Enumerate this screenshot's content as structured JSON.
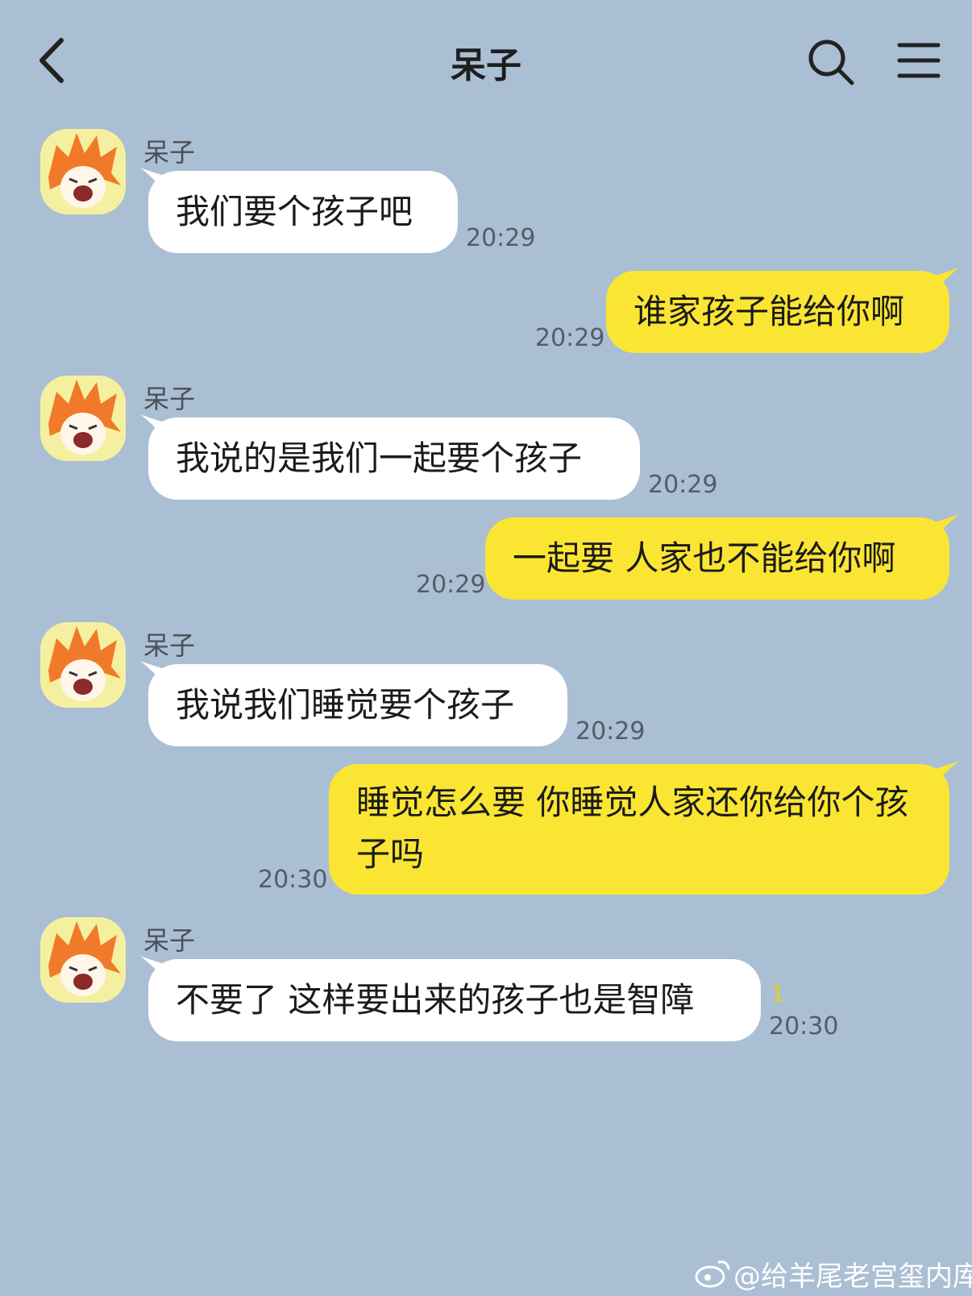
{
  "header": {
    "title": "呆子",
    "back_icon": "back-chevron-icon",
    "search_icon": "search-icon",
    "menu_icon": "menu-icon"
  },
  "messages": [
    {
      "side": "left",
      "sender": "呆子",
      "text": "我们要个孩子吧",
      "time": "20:29"
    },
    {
      "side": "right",
      "text": "谁家孩子能给你啊",
      "time": "20:29"
    },
    {
      "side": "left",
      "sender": "呆子",
      "text": "我说的是我们一起要个孩子",
      "time": "20:29"
    },
    {
      "side": "right",
      "text": "一起要 人家也不能给你啊",
      "time": "20:29"
    },
    {
      "side": "left",
      "sender": "呆子",
      "text": "我说我们睡觉要个孩子",
      "time": "20:29"
    },
    {
      "side": "right",
      "text": "睡觉怎么要  你睡觉人家还你给你个孩子吗",
      "time": "20:30"
    },
    {
      "side": "left",
      "sender": "呆子",
      "text": "不要了 这样要出来的孩子也是智障",
      "time": "20:30",
      "unread": "1"
    }
  ],
  "watermark": "@给羊尾老宫玺内库",
  "colors": {
    "background": "#aabfd3",
    "incoming_bubble": "#ffffff",
    "outgoing_bubble": "#fbe533",
    "unread": "#e9cf1a"
  }
}
